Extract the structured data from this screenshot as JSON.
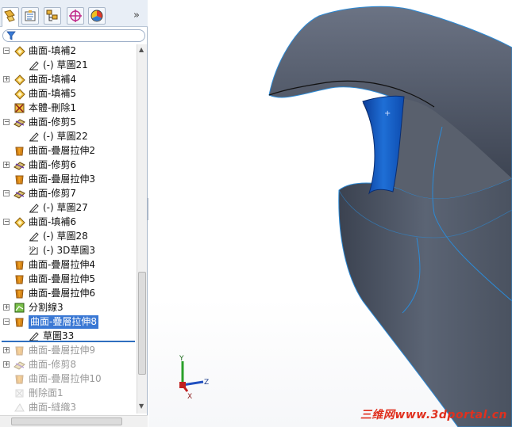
{
  "manager_tabs": [
    {
      "name": "feature-manager",
      "icon": "feature-tree-icon"
    },
    {
      "name": "property-manager",
      "icon": "property-icon"
    },
    {
      "name": "configuration-manager",
      "icon": "configuration-icon"
    },
    {
      "name": "dimxpert-manager",
      "icon": "target-icon"
    },
    {
      "name": "display-manager",
      "icon": "color-wheel-icon"
    }
  ],
  "tab_more": "»",
  "tree": {
    "items": [
      {
        "label": "曲面-填補2",
        "indent": 1,
        "expander": "−",
        "icon": "fill-surface-icon"
      },
      {
        "label": "(-) 草圖21",
        "indent": 2,
        "expander": "",
        "icon": "sketch-icon"
      },
      {
        "label": "曲面-填補4",
        "indent": 1,
        "expander": "+",
        "icon": "fill-surface-icon"
      },
      {
        "label": "曲面-填補5",
        "indent": 1,
        "expander": "",
        "icon": "fill-surface-icon"
      },
      {
        "label": "本體-刪除1",
        "indent": 1,
        "expander": "",
        "icon": "delete-body-icon"
      },
      {
        "label": "曲面-修剪5",
        "indent": 1,
        "expander": "−",
        "icon": "trim-surface-icon"
      },
      {
        "label": "(-) 草圖22",
        "indent": 2,
        "expander": "",
        "icon": "sketch-icon"
      },
      {
        "label": "曲面-疊層拉伸2",
        "indent": 1,
        "expander": "",
        "icon": "loft-surface-icon"
      },
      {
        "label": "曲面-修剪6",
        "indent": 1,
        "expander": "+",
        "icon": "trim-surface-icon"
      },
      {
        "label": "曲面-疊層拉伸3",
        "indent": 1,
        "expander": "",
        "icon": "loft-surface-icon"
      },
      {
        "label": "曲面-修剪7",
        "indent": 1,
        "expander": "−",
        "icon": "trim-surface-icon"
      },
      {
        "label": "(-) 草圖27",
        "indent": 2,
        "expander": "",
        "icon": "sketch-icon"
      },
      {
        "label": "曲面-填補6",
        "indent": 1,
        "expander": "−",
        "icon": "fill-surface-icon"
      },
      {
        "label": "(-) 草圖28",
        "indent": 2,
        "expander": "",
        "icon": "sketch-icon"
      },
      {
        "label": "(-) 3D草圖3",
        "indent": 2,
        "expander": "",
        "icon": "3d-sketch-icon"
      },
      {
        "label": "曲面-疊層拉伸4",
        "indent": 1,
        "expander": "",
        "icon": "loft-surface-icon"
      },
      {
        "label": "曲面-疊層拉伸5",
        "indent": 1,
        "expander": "",
        "icon": "loft-surface-icon"
      },
      {
        "label": "曲面-疊層拉伸6",
        "indent": 1,
        "expander": "",
        "icon": "loft-surface-icon"
      },
      {
        "label": "分割線3",
        "indent": 1,
        "expander": "+",
        "icon": "split-line-icon"
      },
      {
        "label": "曲面-疊層拉伸8",
        "indent": 1,
        "expander": "−",
        "icon": "loft-surface-icon",
        "selected": true
      },
      {
        "label": "草圖33",
        "indent": 2,
        "expander": "",
        "icon": "sketch-icon"
      },
      {
        "label": "曲面-疊層拉伸9",
        "indent": 1,
        "expander": "+",
        "icon": "loft-surface-icon",
        "dim": true
      },
      {
        "label": "曲面-修剪8",
        "indent": 1,
        "expander": "+",
        "icon": "trim-surface-icon",
        "dim": true
      },
      {
        "label": "曲面-疊層拉伸10",
        "indent": 1,
        "expander": "",
        "icon": "loft-surface-icon",
        "dim": true
      },
      {
        "label": "刪除面1",
        "indent": 1,
        "expander": "",
        "icon": "delete-face-icon",
        "dim": true
      },
      {
        "label": "曲面-縫織3",
        "indent": 1,
        "expander": "",
        "icon": "knit-surface-icon",
        "dim": true
      }
    ]
  },
  "watermark": "三维网www.3dportal.cn",
  "triad_labels": {
    "x": "X",
    "y": "Y",
    "z": "Z"
  },
  "colors": {
    "selection": "#3a78d4",
    "model_body": "#4a5260",
    "model_highlight": "#1f6fd6",
    "watermark": "#e0301e"
  }
}
